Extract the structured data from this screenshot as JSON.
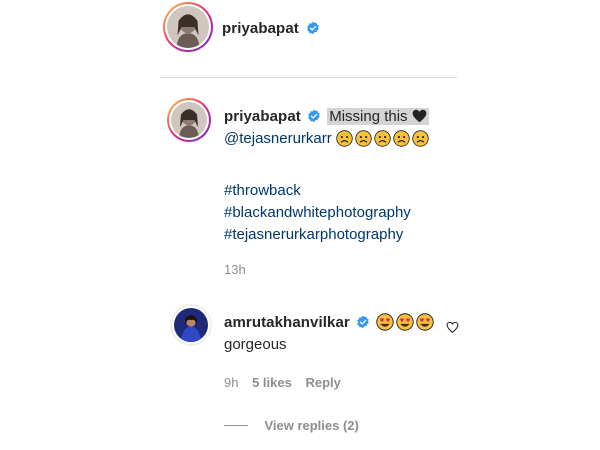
{
  "header": {
    "username": "priyabapat"
  },
  "caption": {
    "username": "priyabapat",
    "text": "Missing this",
    "mention": "@tejasnerurkarr",
    "hashtags": [
      "#throwback",
      "#blackandwhitephotography",
      "#tejasnerurkarphotography"
    ],
    "time": "13h"
  },
  "comment": {
    "username": "amrutakhanvilkar",
    "text": "gorgeous",
    "time": "9h",
    "likes": "5 likes",
    "reply_label": "Reply",
    "view_replies": "View replies (2)"
  },
  "colors": {
    "verified": "#3897f0",
    "link": "#00376b",
    "meta": "#8e8e8e",
    "divider": "#dbdbdb"
  },
  "icons": {
    "verified": "verified-badge-icon",
    "black-heart": "black-heart-icon",
    "sad-emoji": "sad-face-emoji",
    "heart-eyes-emoji": "heart-eyes-emoji",
    "like": "heart-outline-icon"
  }
}
